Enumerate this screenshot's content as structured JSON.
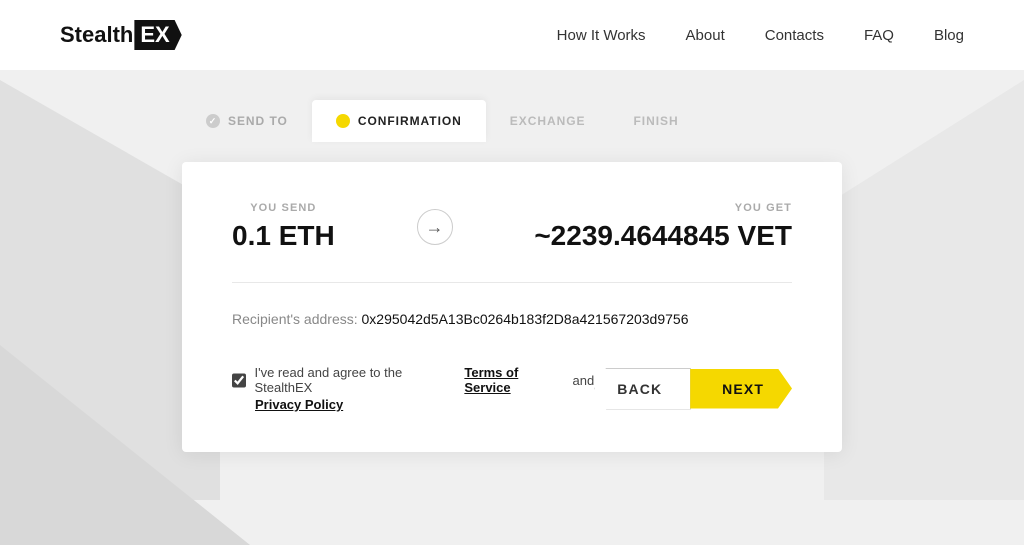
{
  "header": {
    "logo_stealth": "Stealth",
    "logo_ex": "EX",
    "nav": {
      "items": [
        {
          "label": "How It Works",
          "href": "#"
        },
        {
          "label": "About",
          "href": "#"
        },
        {
          "label": "Contacts",
          "href": "#"
        },
        {
          "label": "FAQ",
          "href": "#"
        },
        {
          "label": "Blog",
          "href": "#"
        }
      ]
    }
  },
  "steps": [
    {
      "id": "send-to",
      "label": "SEND TO",
      "state": "completed"
    },
    {
      "id": "confirmation",
      "label": "CONFIRMATION",
      "state": "active"
    },
    {
      "id": "exchange",
      "label": "EXCHANGE",
      "state": "inactive"
    },
    {
      "id": "finish",
      "label": "FINISH",
      "state": "inactive"
    }
  ],
  "card": {
    "send_label": "YOU SEND",
    "send_amount": "0.1 ETH",
    "get_label": "YOU GET",
    "get_amount": "~2239.4644845 VET",
    "recipient_label": "Recipient's address:",
    "recipient_address": "0x295042d5A13Bc0264b183f2D8a421567203d9756",
    "checkbox_text_1": "I've read and agree to the StealthEX",
    "terms_link": "Terms of Service",
    "checkbox_text_2": "and",
    "privacy_link": "Privacy Policy",
    "btn_back": "BACK",
    "btn_next": "NEXT"
  }
}
